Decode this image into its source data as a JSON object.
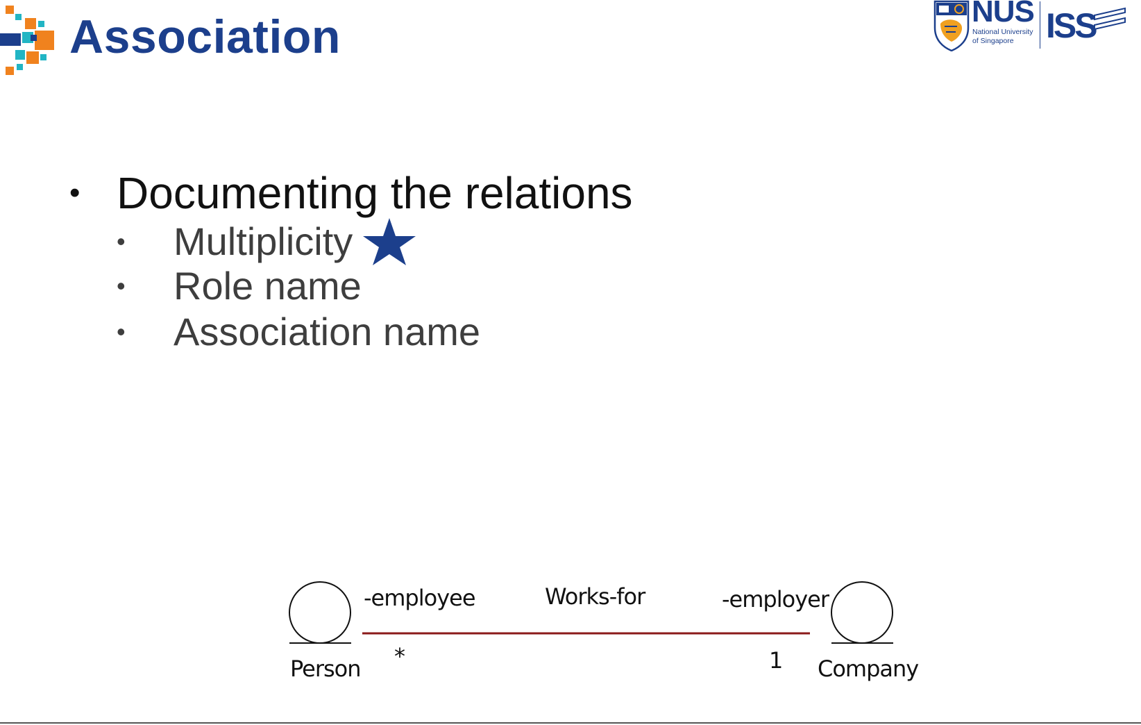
{
  "slide": {
    "title": "Association",
    "logos": {
      "nus_word": "NUS",
      "nus_line1": "National University",
      "nus_line2": "of Singapore",
      "iss_text": "ISS"
    },
    "bullets": [
      {
        "text": "Documenting the relations",
        "sub_items": [
          "Multiplicity",
          "Role name",
          "Association name"
        ]
      }
    ],
    "highlight_icon": "star-icon",
    "colors": {
      "title": "#1c3f8c",
      "star": "#1c3f8c",
      "association_line": "#8b1a1a",
      "icon_orange": "#f0821e",
      "icon_teal": "#22b5c4"
    }
  },
  "diagram": {
    "classes": [
      {
        "name": "Person"
      },
      {
        "name": "Company"
      }
    ],
    "association": {
      "name": "Works-for",
      "left_role": "-employee",
      "left_multiplicity": "*",
      "right_role": "-employer",
      "right_multiplicity": "1"
    }
  }
}
